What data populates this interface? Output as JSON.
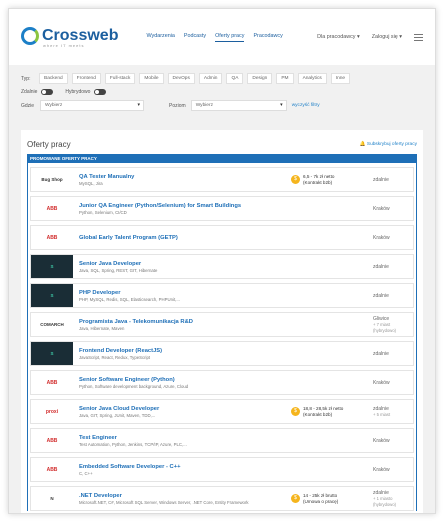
{
  "header": {
    "logo_text": "Crossweb",
    "logo_sub": "where IT meets",
    "nav": [
      "Wydarzenia",
      "Podcasty",
      "Oferty pracy",
      "Pracodawcy"
    ],
    "active_index": 2,
    "employers_label": "Dla pracodawcy ▾",
    "login_label": "Zaloguj się ▾"
  },
  "filters": {
    "type_label": "Typ",
    "types": [
      "Backend",
      "Frontend",
      "Full-stack",
      "Mobile",
      "DevOps",
      "Admin",
      "QA",
      "Design",
      "PM",
      "Analytics",
      "Inne"
    ],
    "remote_label": "Zdalnie",
    "hybrid_label": "Hybrydowo",
    "where_label": "Gdzie",
    "where_placeholder": "Wybierz",
    "level_label": "Poziom",
    "level_placeholder": "Wybierz",
    "reset_label": "wyczyść filtry"
  },
  "offers": {
    "title": "Oferty pracy",
    "subscribe_label": "Subskrybuj oferty pracy",
    "promo_label": "PROMOWANE OFERTY PRACY",
    "jobs": [
      {
        "logo": "Bug Shop",
        "logo_style": "plain",
        "title": "QA Tester Manualny",
        "skills": "MySQL, Jira",
        "salary": "6,5 - 7k zł netto",
        "salary_note": "(Kontrakt b2b)",
        "location": "zdalnie",
        "location_note": ""
      },
      {
        "logo": "ABB",
        "logo_style": "red",
        "title": "Junior QA Engineer (Python/Selenium) for Smart Buildings",
        "skills": "Python, Selenium, CI/CD",
        "salary": "",
        "salary_note": "",
        "location": "Kraków",
        "location_note": ""
      },
      {
        "logo": "ABB",
        "logo_style": "red",
        "title": "Global Early Talent Program (GETP)",
        "skills": "",
        "salary": "",
        "salary_note": "",
        "location": "Kraków",
        "location_note": ""
      },
      {
        "logo": "S",
        "logo_style": "dark",
        "title": "Senior Java Developer",
        "skills": "Java, SQL, Spring, REST, GIT, Hibernate",
        "salary": "",
        "salary_note": "",
        "location": "zdalnie",
        "location_note": ""
      },
      {
        "logo": "S",
        "logo_style": "dark",
        "title": "PHP Developer",
        "skills": "PHP, MySQL, Redis, SQL, Elasticsearch, PHPUnit,...",
        "salary": "",
        "salary_note": "",
        "location": "zdalnie",
        "location_note": ""
      },
      {
        "logo": "COMARCH",
        "logo_style": "plain",
        "title": "Programista Java - Telekomunikacja R&D",
        "skills": "Java, Hibernate, Maven",
        "salary": "",
        "salary_note": "",
        "location": "Gliwice",
        "location_note": "+ 7 miast (hybrydowo)"
      },
      {
        "logo": "S",
        "logo_style": "dark",
        "title": "Frontend Developer (ReactJS)",
        "skills": "JavaScript, React, Redux, TypeScript",
        "salary": "",
        "salary_note": "",
        "location": "zdalnie",
        "location_note": ""
      },
      {
        "logo": "ABB",
        "logo_style": "red",
        "title": "Senior Software Engineer (Python)",
        "skills": "Python, Software development background, Azure, Cloud",
        "salary": "",
        "salary_note": "",
        "location": "Kraków",
        "location_note": ""
      },
      {
        "logo": "proxi",
        "logo_style": "red",
        "title": "Senior Java Cloud Developer",
        "skills": "Java, GIT, Spring, JUnit, Maven, TDD,...",
        "salary": "18,8 - 28,5k zł netto",
        "salary_note": "(Kontrakt b2b)",
        "location": "zdalnie",
        "location_note": "+ 5 miast"
      },
      {
        "logo": "ABB",
        "logo_style": "red",
        "title": "Test Engineer",
        "skills": "Test Automation, Python, Jenkins, TCP/IP, Azure, PLC,...",
        "salary": "",
        "salary_note": "",
        "location": "Kraków",
        "location_note": ""
      },
      {
        "logo": "ABB",
        "logo_style": "red",
        "title": "Embedded Software Developer - C++",
        "skills": "C, C++",
        "salary": "",
        "salary_note": "",
        "location": "Kraków",
        "location_note": ""
      },
      {
        "logo": "N",
        "logo_style": "plain",
        "title": ".NET Developer",
        "skills": "Microsoft.NET, C#, Microsoft SQL Server, Windows Server, .NET Core, Entity Framework",
        "salary": "14 - 25k zł brutto",
        "salary_note": "(Umowa o pracę)",
        "location": "zdalnie",
        "location_note": "+ 1 miasto (hybrydowo)"
      }
    ]
  },
  "colors": {
    "accent": "#1e6fb7",
    "coin": "#f5b51d",
    "abb_red": "#d22d2d"
  }
}
